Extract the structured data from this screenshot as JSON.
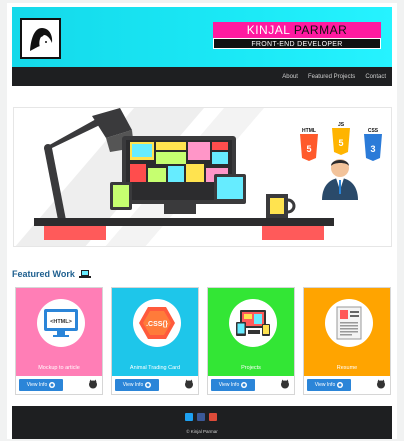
{
  "header": {
    "name_first": "KINJAL",
    "name_last": "PARMAR",
    "role": "FRONT-END DEVELOPER"
  },
  "nav": {
    "items": [
      "About",
      "Featured Projects",
      "Contact"
    ]
  },
  "hero": {
    "badges": [
      "HTML",
      "JS",
      "CSS"
    ]
  },
  "featured": {
    "title": "Featured Work",
    "cards": [
      {
        "title": "Mockup to article",
        "button": "View Info",
        "color": "#ff7eb6",
        "icon_text": "<HTML>"
      },
      {
        "title": "Animal Trading Card",
        "button": "View Info",
        "color": "#1ec6ea",
        "icon_text": ".CSS{}"
      },
      {
        "title": "Projects",
        "button": "View Info",
        "color": "#33e635"
      },
      {
        "title": "Resume",
        "button": "View Info",
        "color": "#ffa400"
      }
    ]
  },
  "footer": {
    "copyright": "© Kinjal Parmar"
  },
  "colors": {
    "header_cyan": "#1be9f6",
    "accent_pink": "#ff1aa0",
    "dark": "#1e1f21",
    "button_blue": "#2b85d8"
  }
}
